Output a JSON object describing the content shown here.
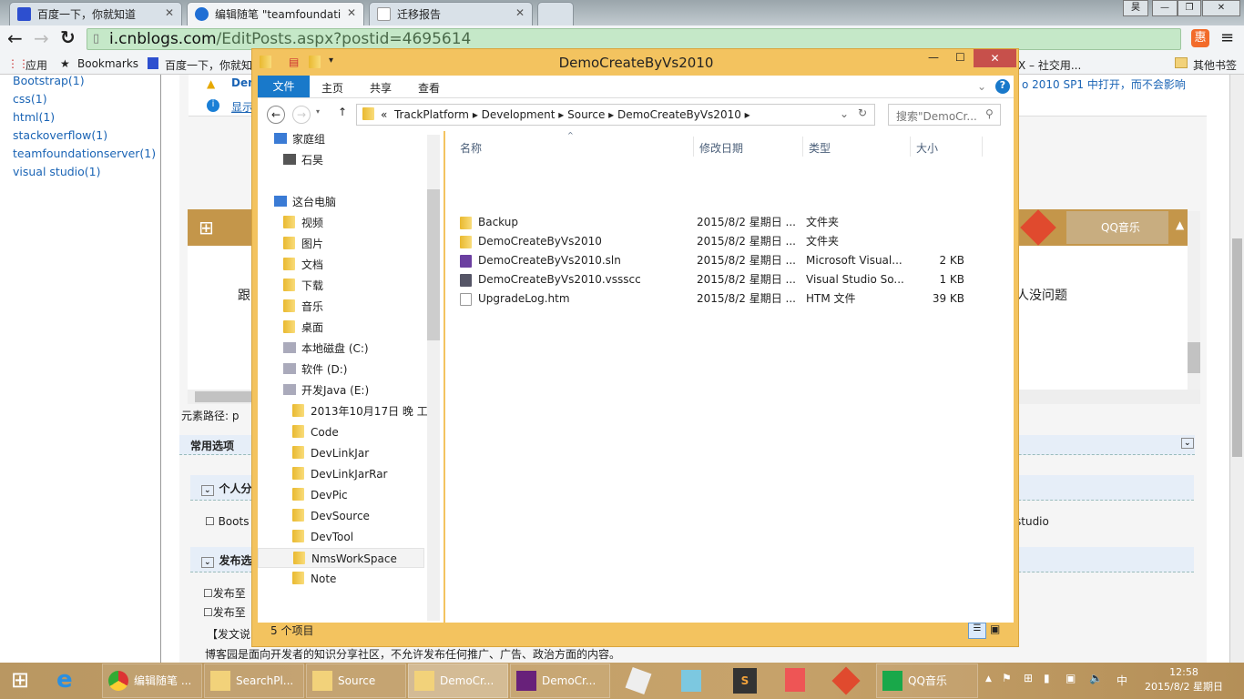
{
  "browser": {
    "tabs": [
      {
        "label": "百度一下，你就知道"
      },
      {
        "label": "编辑随笔 \"teamfoundati"
      },
      {
        "label": "迁移报告"
      }
    ],
    "user_button": "昊",
    "url_host": "i.cnblogs.com",
    "url_path": "/EditPosts.aspx?postid=4695614",
    "bookmarks": [
      {
        "label": "应用"
      },
      {
        "label": "Bookmarks"
      },
      {
        "label": "百度一下，你就知"
      },
      {
        "label": "X – 社交用..."
      }
    ],
    "other_bookmarks": "其他书签"
  },
  "sidebar": {
    "tags": [
      "Bootstrap(1)",
      "css(1)",
      "html(1)",
      "stackoverflow(1)",
      "teamfoundationserver(1)",
      "visual studio(1)"
    ]
  },
  "page": {
    "warning_text": "Dem",
    "info_link": "显示",
    "right_notice": "o 2010 SP1 中打开，而不会影响",
    "editor_text_left": "跟",
    "editor_text_right": "人没问题",
    "element_path_label": "元素路径:",
    "element_path_value": "p",
    "common_options": "常用选项",
    "personal_category": "个人分",
    "category_checkbox": "Boots",
    "category_right": "studio",
    "publish_options": "发布选",
    "publish1": "发布至",
    "publish2": "发布至",
    "notice_title": "【发文说",
    "notice_text": "博客园是面向开发者的知识分享社区，不允许发布任何推广、广告、政治方面的内容。",
    "embedded_qq": "QQ音乐"
  },
  "explorer": {
    "title": "DemoCreateByVs2010",
    "ribbon_tabs": [
      "文件",
      "主页",
      "共享",
      "查看"
    ],
    "breadcrumb": [
      "TrackPlatform",
      "Development",
      "Source",
      "DemoCreateByVs2010"
    ],
    "search_placeholder": "搜索\"DemoCr...",
    "nav": [
      "家庭组",
      "石昊",
      "这台电脑",
      "视频",
      "图片",
      "文档",
      "下载",
      "音乐",
      "桌面",
      "本地磁盘 (C:)",
      "软件 (D:)",
      "开发Java (E:)",
      "2013年10月17日 晚 工",
      "Code",
      "DevLinkJar",
      "DevLinkJarRar",
      "DevPic",
      "DevSource",
      "DevTool",
      "NmsWorkSpace",
      "Note"
    ],
    "columns": [
      "名称",
      "修改日期",
      "类型",
      "大小"
    ],
    "files": [
      {
        "name": "Backup",
        "date": "2015/8/2 星期日 ...",
        "type": "文件夹",
        "size": "",
        "icon": "folder"
      },
      {
        "name": "DemoCreateByVs2010",
        "date": "2015/8/2 星期日 ...",
        "type": "文件夹",
        "size": "",
        "icon": "folder"
      },
      {
        "name": "DemoCreateByVs2010.sln",
        "date": "2015/8/2 星期日 ...",
        "type": "Microsoft Visual...",
        "size": "2 KB",
        "icon": "sln"
      },
      {
        "name": "DemoCreateByVs2010.vssscc",
        "date": "2015/8/2 星期日 ...",
        "type": "Visual Studio So...",
        "size": "1 KB",
        "icon": "vssscc"
      },
      {
        "name": "UpgradeLog.htm",
        "date": "2015/8/2 星期日 ...",
        "type": "HTM 文件",
        "size": "39 KB",
        "icon": "htm"
      }
    ],
    "status": "5 个项目"
  },
  "taskbar": {
    "items": [
      {
        "label": "编辑随笔 ..."
      },
      {
        "label": "SearchPl..."
      },
      {
        "label": "Source"
      },
      {
        "label": "DemoCr..."
      },
      {
        "label": "DemoCr..."
      },
      {
        "label": "QQ音乐"
      }
    ],
    "ime": "中",
    "time": "12:58",
    "date": "2015/8/2 星期日"
  },
  "colors": {
    "explorer_border": "#f3c35f",
    "ribbon_file": "#1979ca",
    "taskbar": "#bf9c66",
    "url_bar": "#c5e8c8",
    "close": "#c7504b"
  }
}
